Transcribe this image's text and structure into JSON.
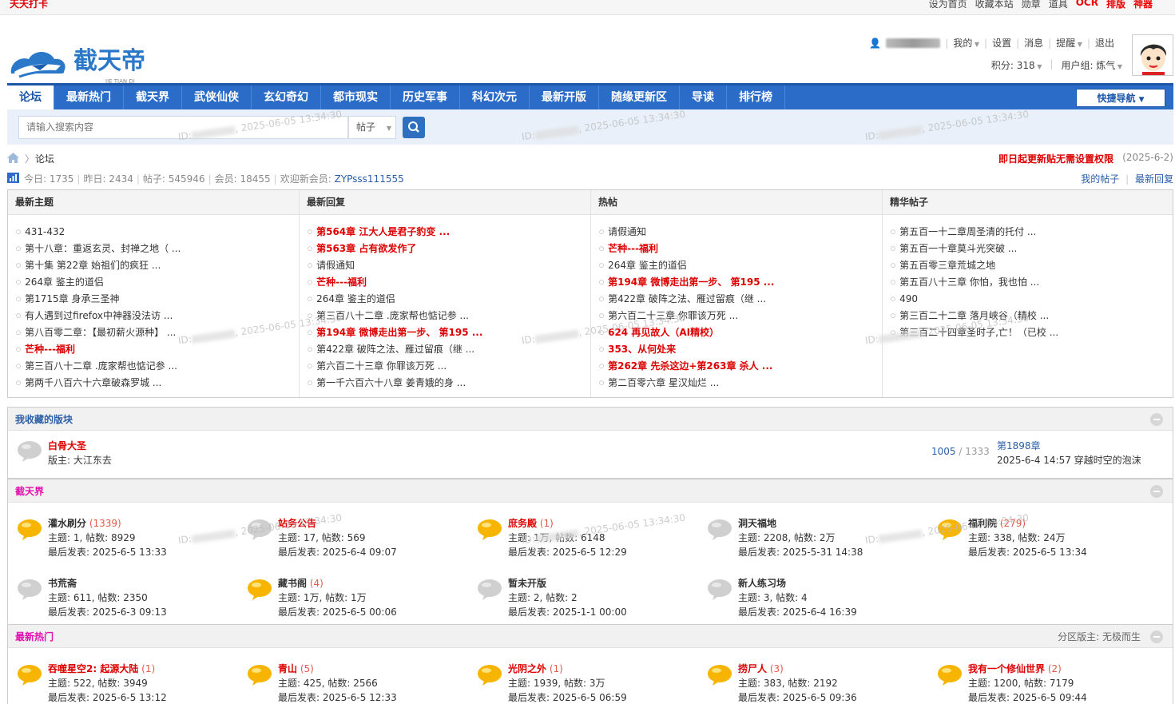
{
  "topbar": {
    "checkin": "天天打卡",
    "links": [
      "设为首页",
      "收藏本站",
      "勋章",
      "道具"
    ],
    "hot_links": [
      "OCR",
      "排版",
      "神器"
    ]
  },
  "logo": {
    "cn": "截天帝",
    "en": "JIE TIAN DI"
  },
  "user": {
    "my": "我的",
    "settings": "设置",
    "messages": "消息",
    "reminders": "提醒",
    "logout": "退出",
    "points_label": "积分: 318",
    "group_label": "用户组: 炼气"
  },
  "nav": {
    "items": [
      "论坛",
      "最新热门",
      "截天界",
      "武侠仙侠",
      "玄幻奇幻",
      "都市现实",
      "历史军事",
      "科幻次元",
      "最新开版",
      "随缘更新区",
      "导读",
      "排行榜"
    ],
    "quick": "快捷导航"
  },
  "search": {
    "placeholder": "请输入搜索内容",
    "type": "帖子"
  },
  "breadcrumb": {
    "current": "论坛",
    "notice": "即日起更新贴无需设置权限",
    "notice_date": "(2025-6-2)"
  },
  "stats": {
    "today": "今日: 1735",
    "yesterday": "昨日: 2434",
    "posts": "帖子: 545946",
    "members": "会员: 18455",
    "welcome": "欢迎新会员:",
    "new_user": "ZYPsss111555",
    "my_posts": "我的帖子",
    "latest_replies": "最新回复"
  },
  "watermark": {
    "text": "2025-06-05 13:34:30",
    "prefix": "ID:"
  },
  "boards": [
    {
      "title": "最新主题",
      "items": [
        {
          "t": "431-432",
          "red": false
        },
        {
          "t": "第十八章：重返玄灵、封禅之地（ ...",
          "red": false
        },
        {
          "t": "第十集 第22章 始祖们的疯狂 ...",
          "red": false
        },
        {
          "t": "264章 鉴主的道侣",
          "red": false
        },
        {
          "t": "第1715章 身承三圣神",
          "red": false
        },
        {
          "t": "有人遇到过firefox中神器没法访 ...",
          "red": false
        },
        {
          "t": "第八百零二章：【最初薪火源种】 ...",
          "red": false
        },
        {
          "t": "芒种---福利",
          "red": true
        },
        {
          "t": "第三百八十二章 .庞家帮也惦记参 ...",
          "red": false
        },
        {
          "t": "第两千八百六十六章破森罗城 ...",
          "red": false
        }
      ]
    },
    {
      "title": "最新回复",
      "items": [
        {
          "t": "第564章 江大人是君子豹变 ...",
          "red": true
        },
        {
          "t": "第563章 占有欲发作了",
          "red": true
        },
        {
          "t": "请假通知",
          "red": false
        },
        {
          "t": "芒种---福利",
          "red": true
        },
        {
          "t": "264章 鉴主的道侣",
          "red": false
        },
        {
          "t": "第三百八十二章 .庞家帮也惦记参 ...",
          "red": false
        },
        {
          "t": "第194章 微博走出第一步、 第195 ...",
          "red": true
        },
        {
          "t": "第422章 破阵之法、雁过留痕（继 ...",
          "red": false
        },
        {
          "t": "第六百二十三章 你罪该万死 ...",
          "red": false
        },
        {
          "t": "第一千六百六十八章 姜青娥的身 ...",
          "red": false
        }
      ]
    },
    {
      "title": "热帖",
      "items": [
        {
          "t": "请假通知",
          "red": false
        },
        {
          "t": "芒种---福利",
          "red": true
        },
        {
          "t": "264章 鉴主的道侣",
          "red": false
        },
        {
          "t": "第194章 微博走出第一步、 第195 ...",
          "red": true
        },
        {
          "t": "第422章 破阵之法、雁过留痕（继 ...",
          "red": false
        },
        {
          "t": "第六百二十三章 你罪该万死 ...",
          "red": false
        },
        {
          "t": "624 再见故人（AI精校）",
          "red": true
        },
        {
          "t": "353、从何处来",
          "red": true
        },
        {
          "t": "第262章 先杀这边+第263章 杀人 ...",
          "red": true
        },
        {
          "t": "第二百零六章 星汉灿烂 ...",
          "red": false
        }
      ]
    },
    {
      "title": "精华帖子",
      "items": [
        {
          "t": "第五百一十二章周圣清的托付 ...",
          "red": false
        },
        {
          "t": "第五百一十章莫斗光突破 ...",
          "red": false
        },
        {
          "t": "第五百零三章荒城之地",
          "red": false
        },
        {
          "t": "第五百八十三章 你怕，我也怕 ...",
          "red": false
        },
        {
          "t": "490",
          "red": false
        },
        {
          "t": "第三百二十二章 落月峡谷（精校 ...",
          "red": false
        },
        {
          "t": "第三百二十四章圣时子,亡！（已校 ...",
          "red": false
        }
      ]
    }
  ],
  "favorites": {
    "title": "我收藏的版块",
    "board": "白骨大圣",
    "mod_label": "版主:",
    "mod": "大江东去",
    "count_a": "1005",
    "count_b": "/ 1333",
    "last_title": "第1898章",
    "last_info": "2025-6-4 14:57 穿越时空的泡沫"
  },
  "section1": {
    "title": "截天界",
    "forums": [
      {
        "name": "灌水刷分",
        "today": "(1339)",
        "red": false,
        "stat": "主题: 1, 帖数: 8929",
        "last": "最后发表: 2025-6-5 13:33",
        "active": true
      },
      {
        "name": "站务公告",
        "today": "",
        "red": true,
        "stat": "主题: 17, 帖数: 569",
        "last": "最后发表: 2025-6-4 09:07",
        "active": false
      },
      {
        "name": "庶务殿",
        "today": "(1)",
        "red": true,
        "stat": "主题: 1万, 帖数: 6148",
        "last": "最后发表: 2025-6-5 12:29",
        "active": true
      },
      {
        "name": "洞天福地",
        "today": "",
        "red": false,
        "stat": "主题: 2208, 帖数: 2万",
        "last": "最后发表: 2025-5-31 14:38",
        "active": false
      },
      {
        "name": "福利院",
        "today": "(279)",
        "red": false,
        "stat": "主题: 338, 帖数: 24万",
        "last": "最后发表: 2025-6-5 13:34",
        "active": true
      },
      {
        "name": "书荒斋",
        "today": "",
        "red": false,
        "stat": "主题: 611, 帖数: 2350",
        "last": "最后发表: 2025-6-3 09:13",
        "active": false
      },
      {
        "name": "藏书阁",
        "today": "(4)",
        "red": false,
        "stat": "主题: 1万, 帖数: 1万",
        "last": "最后发表: 2025-6-5 00:06",
        "active": true
      },
      {
        "name": "暂未开版",
        "today": "",
        "red": false,
        "stat": "主题: 2, 帖数: 2",
        "last": "最后发表: 2025-1-1 00:00",
        "active": false
      },
      {
        "name": "新人练习场",
        "today": "",
        "red": false,
        "stat": "主题: 3, 帖数: 4",
        "last": "最后发表: 2025-6-4 16:39",
        "active": false
      }
    ]
  },
  "section2": {
    "title": "最新热门",
    "mod_label": "分区版主:",
    "mod": "无极而生",
    "forums": [
      {
        "name": "吞噬星空2: 起源大陆",
        "today": "(1)",
        "red": true,
        "stat": "主题: 522, 帖数: 3949",
        "last": "最后发表: 2025-6-5 13:12",
        "active": true
      },
      {
        "name": "青山",
        "today": "(5)",
        "red": true,
        "stat": "主题: 425, 帖数: 2566",
        "last": "最后发表: 2025-6-5 12:33",
        "active": true
      },
      {
        "name": "光阴之外",
        "today": "(1)",
        "red": true,
        "stat": "主题: 1939, 帖数: 3万",
        "last": "最后发表: 2025-6-5 06:59",
        "active": true
      },
      {
        "name": "捞尸人",
        "today": "(3)",
        "red": true,
        "stat": "主题: 383, 帖数: 2192",
        "last": "最后发表: 2025-6-5 09:36",
        "active": true
      },
      {
        "name": "我有一个修仙世界",
        "today": "(2)",
        "red": true,
        "stat": "主题: 1200, 帖数: 7179",
        "last": "最后发表: 2025-6-5 09:44",
        "active": true
      }
    ]
  },
  "colors": {
    "nav": "#2a6cc7",
    "red": "#dd0000",
    "link": "#2a5ea8",
    "pink": "#e20fae"
  }
}
